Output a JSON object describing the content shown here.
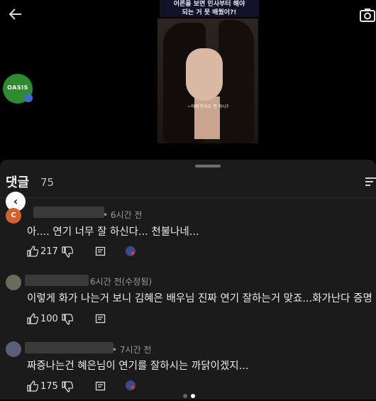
{
  "video": {
    "caption_line1": "어른을 보면 인사부터 해야",
    "caption_line2": "되는 거 못 배웠어?!",
    "subtitle": "~이제 인사도 안 하니?",
    "channel_logo_text": "OASIS"
  },
  "comments_header": {
    "title": "댓글",
    "count": "75"
  },
  "comments": [
    {
      "meta": "• 6시간 전",
      "text": "아.... 연기 너무 잘 하신다... 천불나네...",
      "likes": "217",
      "avatar_color": "#d4622e",
      "avatar_letter": "C"
    },
    {
      "meta": "6시간 전(수정됨)",
      "text": "이렇게 화가 나는거 보니 김혜은 배우님 진짜 연기 잘하는거 맞죠...화가난다 증명",
      "likes": "100",
      "avatar_color": "#6c6c5a",
      "avatar_letter": ""
    },
    {
      "meta": "• 7시간 전",
      "text": "짜증나는건 혜은님이 연기를 잘하시는 까닭이겠지...",
      "likes": "175",
      "avatar_color": "#5b5f7a",
      "avatar_letter": ""
    }
  ],
  "colors": {
    "background": "#000000",
    "panel": "#1b1b1b",
    "heart_badge": "#e53935",
    "logo_green": "#2e8a2e"
  },
  "icons": [
    "back-arrow-icon",
    "camera-icon",
    "sort-icon",
    "thumbs-up-icon",
    "thumbs-down-icon",
    "reply-icon",
    "creator-heart-icon",
    "nav-left-icon"
  ]
}
